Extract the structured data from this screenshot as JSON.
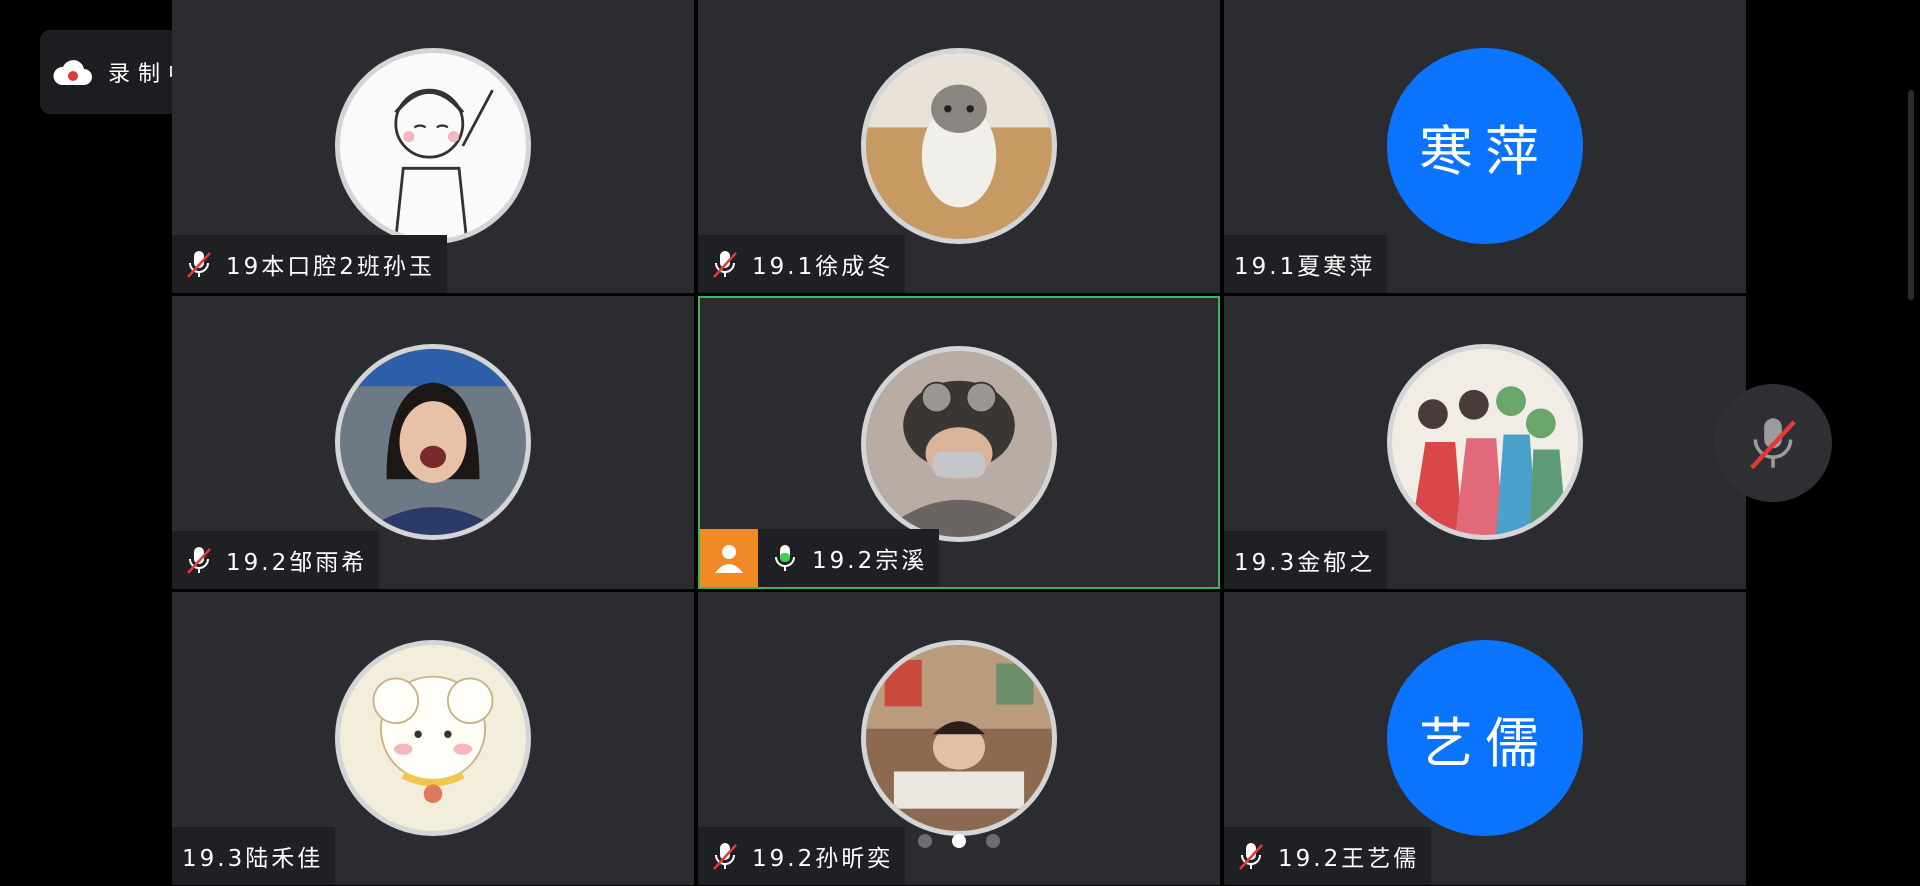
{
  "recording": {
    "label": "录制中"
  },
  "participants": [
    {
      "name": "19本口腔2班孙玉",
      "muted": true
    },
    {
      "name": "19.1徐成冬",
      "muted": true
    },
    {
      "name": "19.1夏寒萍",
      "muted": false,
      "avatar_text": "寒萍"
    },
    {
      "name": "19.2邹雨希",
      "muted": true
    },
    {
      "name": "19.2宗溪",
      "muted": false,
      "speaking": true,
      "host": true
    },
    {
      "name": "19.3金郁之",
      "muted": false
    },
    {
      "name": "19.3陆禾佳",
      "muted": false
    },
    {
      "name": "19.2孙昕奕",
      "muted": true
    },
    {
      "name": "19.2王艺儒",
      "muted": true,
      "avatar_text": "艺儒"
    }
  ],
  "pagination": {
    "total": 3,
    "current": 2
  },
  "colors": {
    "accent_blue": "#0a74ff",
    "active_border": "#3fb55b",
    "host_badge": "#f08a24",
    "mute_red": "#e53935"
  }
}
